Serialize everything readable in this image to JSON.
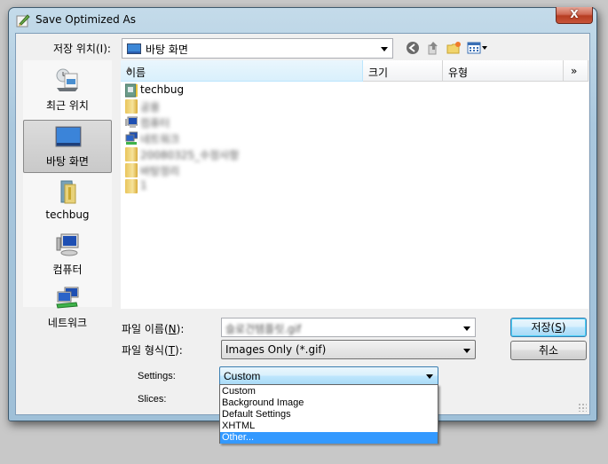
{
  "window": {
    "title": "Save Optimized As",
    "close_label": "X"
  },
  "save_in": {
    "label": "저장 위치(I):",
    "value": "바탕 화면"
  },
  "toolbar": {
    "icons": [
      "back-icon",
      "up-folder-icon",
      "new-folder-icon",
      "view-menu-icon"
    ]
  },
  "places": [
    {
      "label": "최근 위치",
      "icon": "recent-places-icon",
      "selected": false
    },
    {
      "label": "바탕 화면",
      "icon": "desktop-icon",
      "selected": true
    },
    {
      "label": "techbug",
      "icon": "user-folder-icon",
      "selected": false
    },
    {
      "label": "컴퓨터",
      "icon": "computer-icon",
      "selected": false
    },
    {
      "label": "네트워크",
      "icon": "network-icon",
      "selected": false
    }
  ],
  "file_list": {
    "columns": [
      "이름",
      "크기",
      "유형",
      "»"
    ],
    "items": [
      {
        "name": "techbug",
        "icon": "user-folder-icon"
      },
      {
        "name": "공용",
        "icon": "folder-icon"
      },
      {
        "name": "컴퓨터",
        "icon": "computer-icon"
      },
      {
        "name": "네트워크",
        "icon": "network-icon"
      },
      {
        "name": "20080325_수정사항",
        "icon": "folder-icon"
      },
      {
        "name": "바탕정리",
        "icon": "folder-icon"
      },
      {
        "name": "1",
        "icon": "folder-icon"
      }
    ]
  },
  "file_name": {
    "label_prefix": "파일 이름(",
    "label_key": "N",
    "label_suffix": "):",
    "value": "슬로건템플릿.gif"
  },
  "file_type": {
    "label_prefix": "파일 형식(",
    "label_key": "T",
    "label_suffix": "):",
    "value": "Images Only (*.gif)"
  },
  "buttons": {
    "save_prefix": "저장(",
    "save_key": "S",
    "save_suffix": ")",
    "cancel": "취소"
  },
  "settings": {
    "label": "Settings:",
    "value": "Custom",
    "options": [
      "Custom",
      "Background Image",
      "Default Settings",
      "XHTML",
      "Other..."
    ],
    "highlighted_index": 4
  },
  "slices": {
    "label": "Slices:"
  }
}
